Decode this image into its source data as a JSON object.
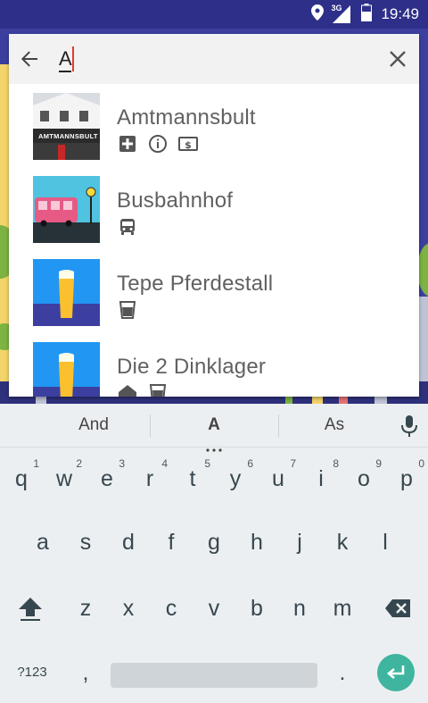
{
  "status": {
    "network": "3G",
    "time": "19:49"
  },
  "search": {
    "query": "A"
  },
  "results": [
    {
      "title": "Amtmannsbult",
      "thumb_sign": "AMTMANNSBULT",
      "tags": [
        "plus-square-icon",
        "info-icon",
        "money-icon"
      ]
    },
    {
      "title": "Busbahnhof",
      "tags": [
        "bus-icon"
      ]
    },
    {
      "title": "Tepe Pferdestall",
      "tags": [
        "drink-glass-icon"
      ]
    },
    {
      "title": "Die 2 Dinklager",
      "tags": [
        "house-icon",
        "drink-glass-icon"
      ]
    }
  ],
  "keyboard": {
    "suggestions": [
      "And",
      "A",
      "As"
    ],
    "row1": [
      "q",
      "w",
      "e",
      "r",
      "t",
      "y",
      "u",
      "i",
      "o",
      "p"
    ],
    "row1_hints": [
      "1",
      "2",
      "3",
      "4",
      "5",
      "6",
      "7",
      "8",
      "9",
      "0"
    ],
    "row2": [
      "a",
      "s",
      "d",
      "f",
      "g",
      "h",
      "j",
      "k",
      "l"
    ],
    "row3": [
      "z",
      "x",
      "c",
      "v",
      "b",
      "n",
      "m"
    ],
    "symbols_label": "?123",
    "comma": ",",
    "period": "."
  },
  "colors": {
    "status_bar": "#2d2f88",
    "enter_key": "#3fb59f",
    "caret": "#e53935"
  }
}
